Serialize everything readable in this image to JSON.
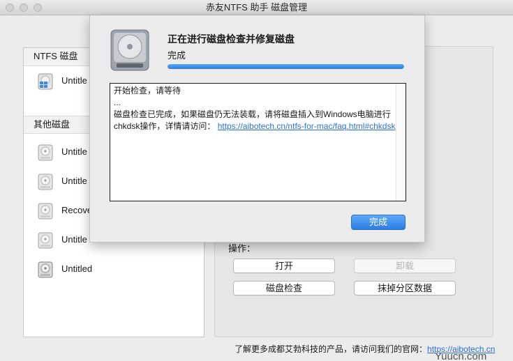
{
  "window": {
    "title": "赤友NTFS 助手 磁盘管理"
  },
  "sidebar": {
    "ntfs_header": "NTFS 磁盘",
    "ntfs_items": [
      {
        "label": "Untitle",
        "icon": "windows-disk-icon"
      }
    ],
    "other_header": "其他磁盘",
    "other_items": [
      {
        "label": "Untitle",
        "icon": "disk-icon"
      },
      {
        "label": "Untitle",
        "icon": "disk-icon"
      },
      {
        "label": "Recove",
        "icon": "disk-icon"
      },
      {
        "label": "Untitle",
        "icon": "disk-icon"
      },
      {
        "label": "Untitled",
        "icon": "disk-icon"
      }
    ]
  },
  "panel": {
    "ops_label": "操作：",
    "buttons": {
      "open": "打开",
      "unmount": "卸载",
      "check": "磁盘检查",
      "erase": "抹掉分区数据"
    }
  },
  "footer": {
    "text": "了解更多成都艾勃科技的产品，请访问我们的官网：",
    "link": "https://aibotech.cn"
  },
  "dialog": {
    "title": "正在进行磁盘检查并修复磁盘",
    "status": "完成",
    "progress": 1.0,
    "log_line1": "开始检查，请等待",
    "log_line2": "...",
    "log_line3": "磁盘检查已完成，如果磁盘仍无法装载，请将磁盘插入到Windows电脑进行chkdsk操作，详情请访问：",
    "log_link": "https://aibotech.cn/ntfs-for-mac/faq.html#chkdsk",
    "done_label": "完成"
  },
  "watermark": "Yuucn.com",
  "colors": {
    "accent": "#2b7de4",
    "link": "#2a72d8"
  }
}
